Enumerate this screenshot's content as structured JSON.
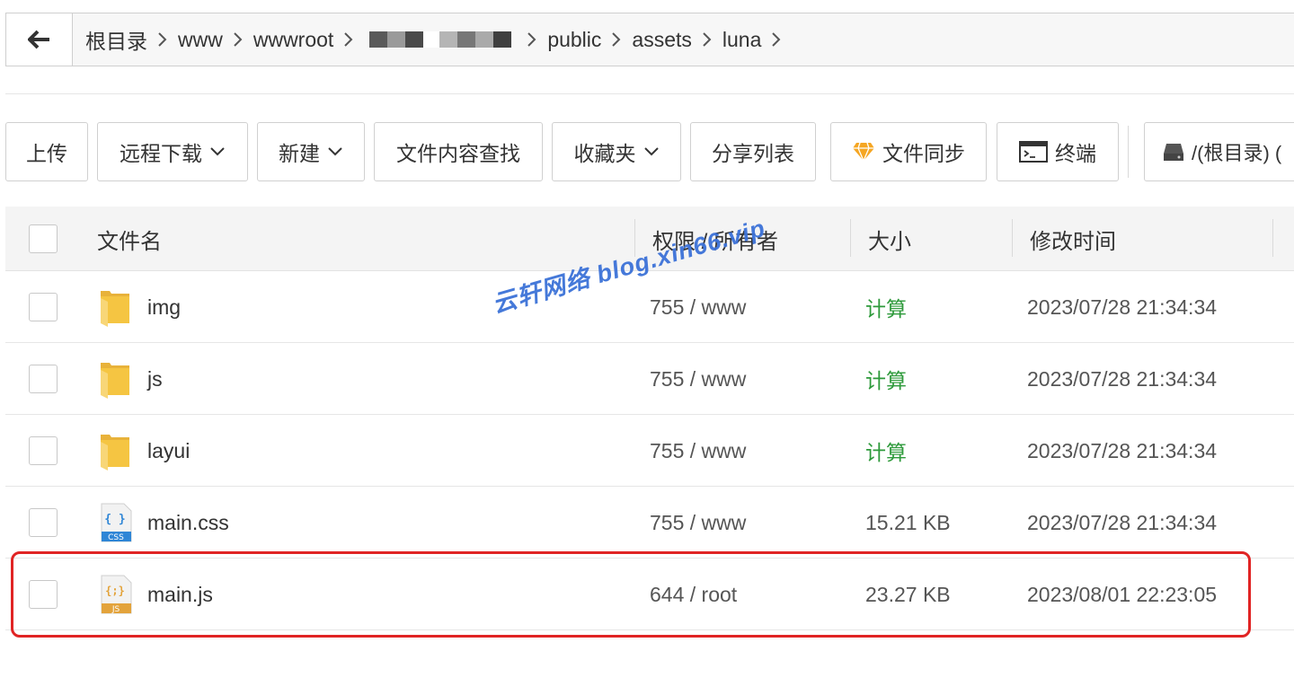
{
  "breadcrumb": {
    "items": [
      "根目录",
      "www",
      "wwwroot",
      "public",
      "assets",
      "luna"
    ]
  },
  "toolbar": {
    "upload": "上传",
    "remote_download": "远程下载",
    "new": "新建",
    "content_search": "文件内容查找",
    "favorites": "收藏夹",
    "share_list": "分享列表",
    "file_sync": "文件同步",
    "terminal": "终端",
    "disk": "/(根目录) ("
  },
  "table": {
    "headers": {
      "name": "文件名",
      "perm": "权限 / 所有者",
      "size": "大小",
      "mtime": "修改时间"
    },
    "rows": [
      {
        "name": "img",
        "type": "folder",
        "perm": "755 / www",
        "size": "计算",
        "mtime": "2023/07/28 21:34:34"
      },
      {
        "name": "js",
        "type": "folder",
        "perm": "755 / www",
        "size": "计算",
        "mtime": "2023/07/28 21:34:34"
      },
      {
        "name": "layui",
        "type": "folder",
        "perm": "755 / www",
        "size": "计算",
        "mtime": "2023/07/28 21:34:34"
      },
      {
        "name": "main.css",
        "type": "css",
        "perm": "755 / www",
        "size": "15.21 KB",
        "mtime": "2023/07/28 21:34:34"
      },
      {
        "name": "main.js",
        "type": "js",
        "perm": "644 / root",
        "size": "23.27 KB",
        "mtime": "2023/08/01 22:23:05"
      }
    ]
  },
  "icons": {
    "css_label": "CSS",
    "js_label": "JS",
    "css_glyph": "{ }",
    "js_glyph": "{;}"
  },
  "watermark": "云轩网络 blog.xin66.vip",
  "colors": {
    "calc_green": "#2e9a3b",
    "highlight_red": "#e02424",
    "folder_yellow": "#f5c542",
    "watermark_blue": "#3c72d8"
  }
}
